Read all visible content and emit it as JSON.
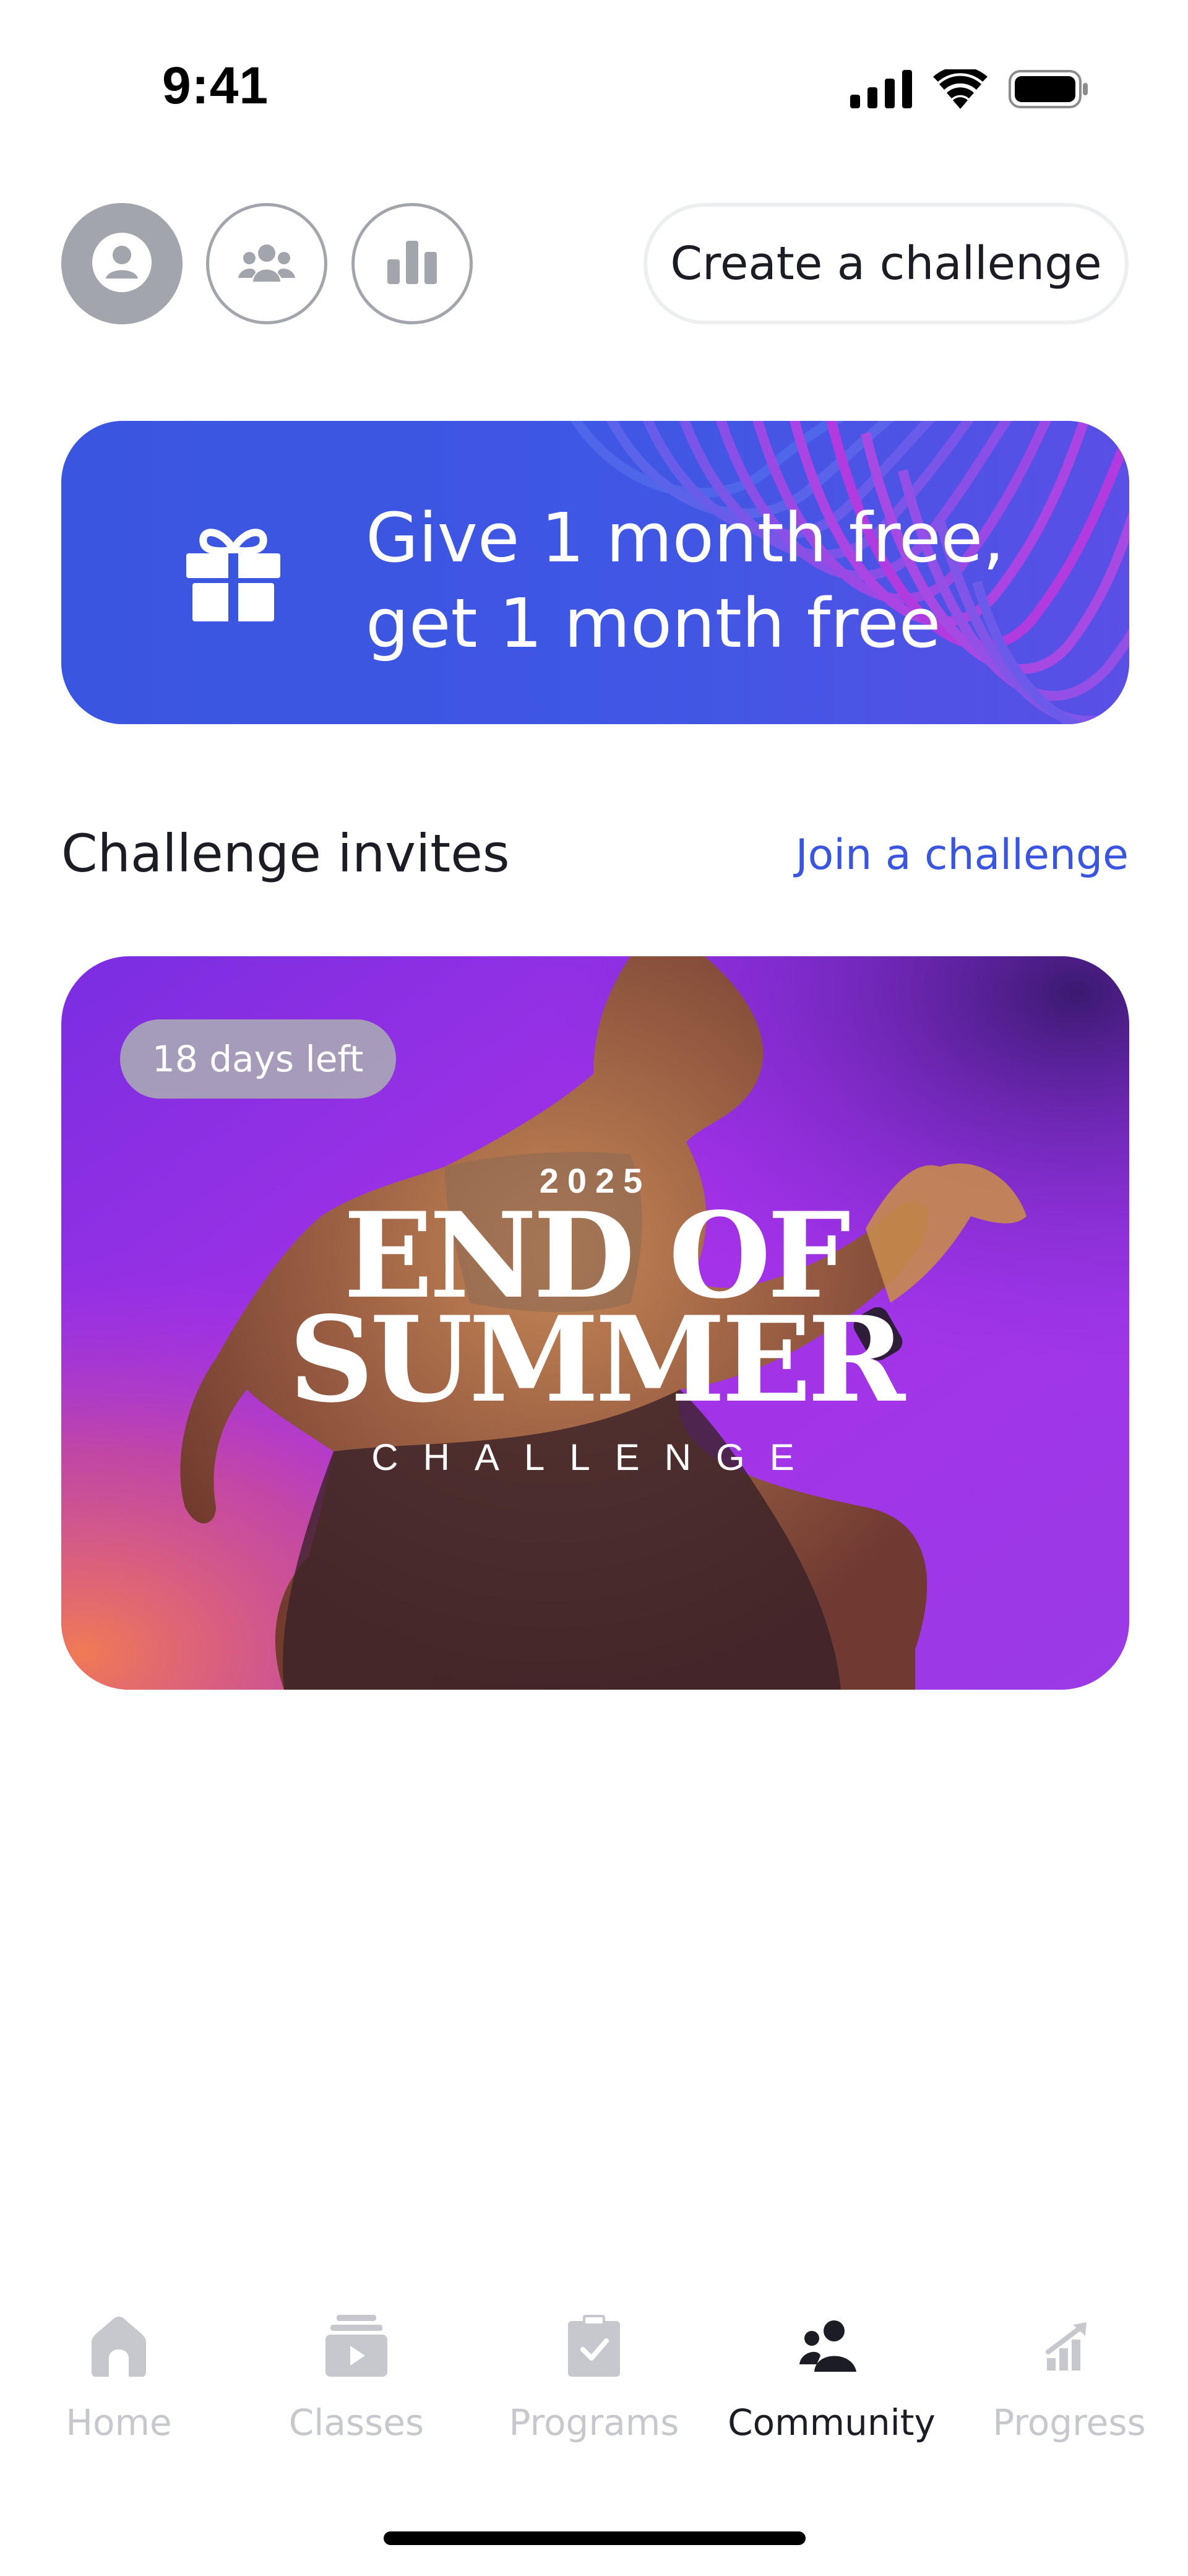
{
  "status_bar": {
    "time": "9:41",
    "icons": [
      "cellular-signal-icon",
      "wifi-icon",
      "battery-icon"
    ]
  },
  "top_controls": {
    "buttons": [
      "profile-icon",
      "group-icon",
      "leaderboard-icon"
    ],
    "create_challenge_label": "Create a challenge"
  },
  "promo": {
    "line1": "Give 1 month free,",
    "line2": "get 1 month free",
    "icon": "gift-icon",
    "background_color": "#3a55e0",
    "accent_color": "#b23be0"
  },
  "challenges": {
    "section_title": "Challenge invites",
    "join_link": "Join a challenge",
    "cards": [
      {
        "badge": "18 days left",
        "year": "2025",
        "title_line1": "END OF",
        "title_line2": "SUMMER",
        "subtitle": "CHALLENGE"
      }
    ]
  },
  "tab_bar": {
    "active": "Community",
    "tabs": [
      {
        "label": "Home",
        "icon": "home-icon"
      },
      {
        "label": "Classes",
        "icon": "classes-icon"
      },
      {
        "label": "Programs",
        "icon": "clipboard-check-icon"
      },
      {
        "label": "Community",
        "icon": "community-icon"
      },
      {
        "label": "Progress",
        "icon": "progress-chart-icon"
      }
    ]
  },
  "colors": {
    "link": "#3a55e0",
    "inactive_tab": "#c7c8cd",
    "active_tab": "#1c1c24"
  }
}
